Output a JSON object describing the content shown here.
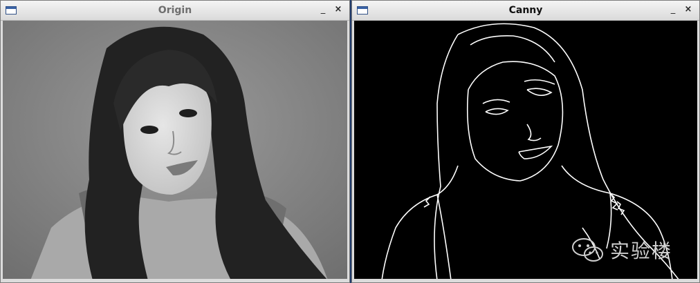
{
  "windows": {
    "origin": {
      "title": "Origin",
      "minimize": "_",
      "close": "×"
    },
    "canny": {
      "title": "Canny",
      "minimize": "_",
      "close": "×"
    }
  },
  "watermark": {
    "text": "实验楼",
    "icon": "wechat-icon"
  }
}
